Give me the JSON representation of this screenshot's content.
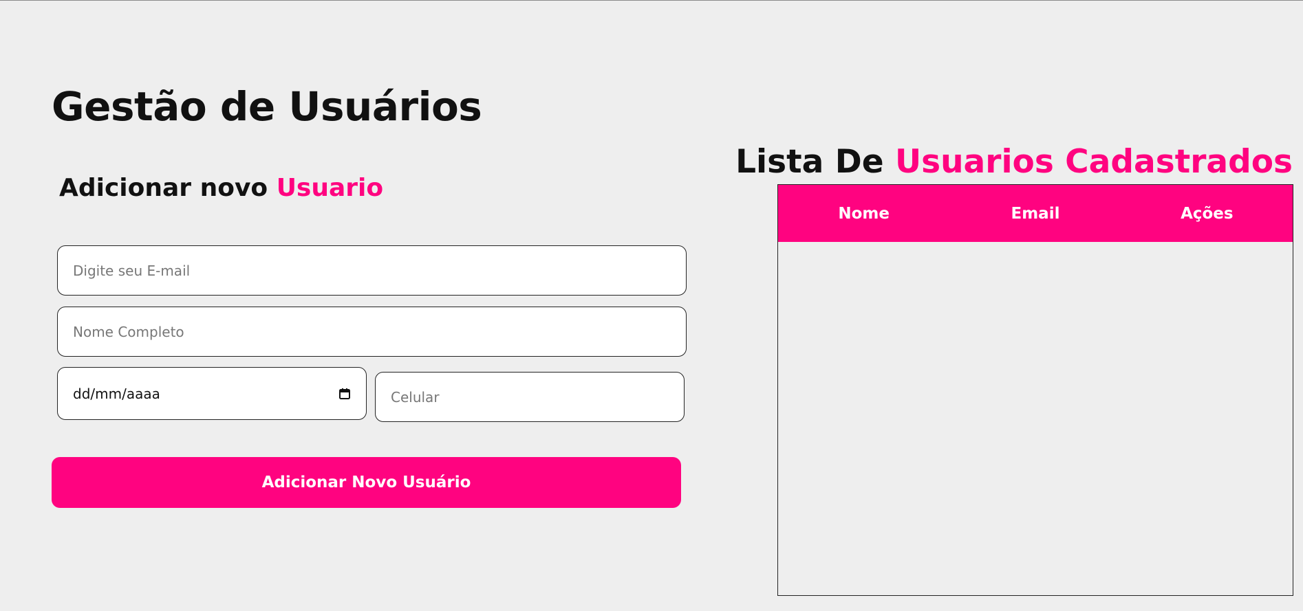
{
  "page": {
    "title": "Gestão de Usuários"
  },
  "form": {
    "heading_prefix": "Adicionar novo ",
    "heading_highlight": "Usuario",
    "email_placeholder": "Digite seu E-mail",
    "name_placeholder": "Nome Completo",
    "birthdate_placeholder": "dd/mm/aaaa",
    "phone_placeholder": "Celular",
    "submit_label": "Adicionar Novo Usuário",
    "date_icon": "calendar-icon"
  },
  "list": {
    "heading_prefix": "Lista De ",
    "heading_highlight": "Usuarios Cadastrados",
    "columns": [
      "Nome",
      "Email",
      "Ações"
    ],
    "rows": []
  },
  "colors": {
    "accent": "#ff0380",
    "background": "#eeeeee",
    "text": "#111111"
  }
}
